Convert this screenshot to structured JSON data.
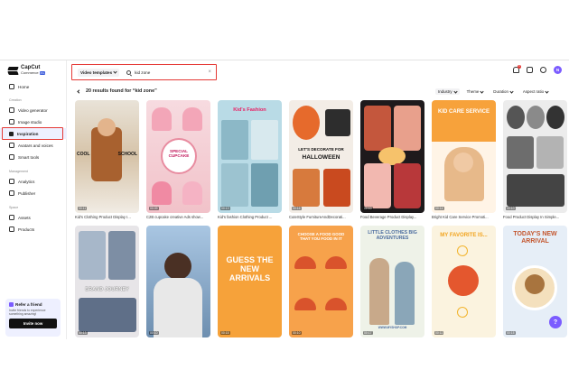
{
  "app": {
    "logo_text": "CapCut",
    "logo_sub": "Commerce",
    "logo_badge": "Pro"
  },
  "sidebar": {
    "home": "Home",
    "creation_section": "Creation",
    "video_generator": "Video generator",
    "image_studio": "Image studio",
    "inspiration": "Inspiration",
    "avatars_voices": "Avatars and voices",
    "smart_tools": "Smart tools",
    "management_section": "Management",
    "analytics": "Analytics",
    "publisher": "Publisher",
    "space_section": "Space",
    "assets": "Assets",
    "products": "Products"
  },
  "refer": {
    "title": "Refer a friend",
    "desc": "Invite friends to experience something amazing!",
    "button": "Invite now"
  },
  "search": {
    "type": "Video templates",
    "value": "kid zone"
  },
  "header": {
    "notif_count": "3",
    "avatar_initial": "N"
  },
  "results": {
    "text": "20 results found for “kid zone”"
  },
  "filters": [
    "Industry",
    "Theme",
    "Duration",
    "Aspect ratio"
  ],
  "templates_row1": [
    {
      "caption": "Kid's Clothing Product Display I...",
      "duration": "00:11",
      "t1": "COOL",
      "t2": "SCHOOL"
    },
    {
      "caption": "C2B cupcake creative Ads show...",
      "duration": "00:09",
      "t1": "SPECIAL CUPCAKE"
    },
    {
      "caption": "Kid's fashion Clothing Product ...",
      "duration": "00:13",
      "t1": "Kid's Fashion"
    },
    {
      "caption": "CuteStyle FurnitureAndDecorati...",
      "duration": "00:16",
      "t1": "LET'S DECORATE FOR",
      "t2": "HALLOWEEN"
    },
    {
      "caption": "Food Beverage Product Display...",
      "duration": "00:10"
    },
    {
      "caption": "Bright Kid Care Service Promoti...",
      "duration": "00:14",
      "t1": "KID CARE SERVICE"
    },
    {
      "caption": "Food Product Display In Simple...",
      "duration": "00:10"
    }
  ],
  "templates_row2": [
    {
      "duration": "00:13",
      "t1": "BRAND JOURNEY"
    },
    {
      "duration": "00:10"
    },
    {
      "duration": "00:15",
      "t1": "GUESS THE NEW ARRIVALS"
    },
    {
      "duration": "00:10",
      "t1": "CHOOSE A FOOD GOOD THAT YOU FOOD IN IT"
    },
    {
      "duration": "00:17",
      "t1": "LITTLE CLOTHES BIG ADVENTURES",
      "t2": "WWW.MYSHOP.COM"
    },
    {
      "duration": "00:11",
      "t1": "MY FAVORITE IS..."
    },
    {
      "duration": "00:15",
      "t1": "TODAY'S NEW ARRIVAL"
    }
  ],
  "colors": {
    "accent": "#7b5cff",
    "highlight": "#e53935",
    "active_bg": "#eef0ff"
  }
}
